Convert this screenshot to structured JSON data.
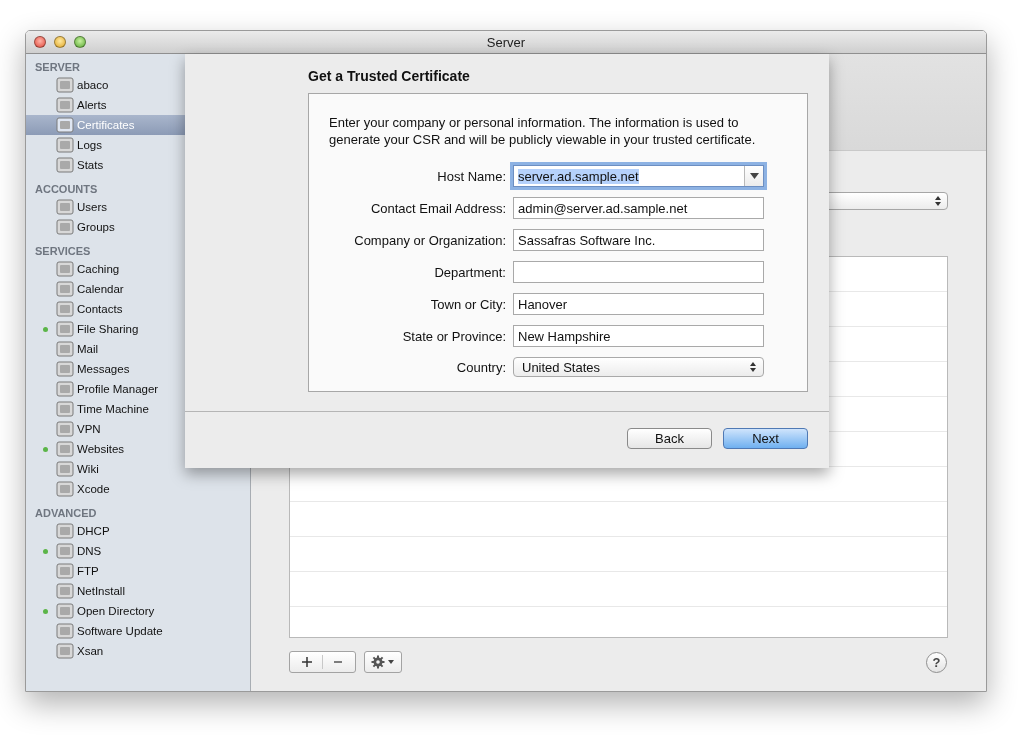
{
  "window": {
    "title": "Server"
  },
  "sidebar": {
    "sections": [
      {
        "heading": "SERVER",
        "items": [
          {
            "label": "abaco",
            "selected": false,
            "running": false
          },
          {
            "label": "Alerts",
            "selected": false,
            "running": false
          },
          {
            "label": "Certificates",
            "selected": true,
            "running": false
          },
          {
            "label": "Logs",
            "selected": false,
            "running": false
          },
          {
            "label": "Stats",
            "selected": false,
            "running": false
          }
        ]
      },
      {
        "heading": "ACCOUNTS",
        "items": [
          {
            "label": "Users",
            "selected": false,
            "running": false
          },
          {
            "label": "Groups",
            "selected": false,
            "running": false
          }
        ]
      },
      {
        "heading": "SERVICES",
        "items": [
          {
            "label": "Caching",
            "selected": false,
            "running": false
          },
          {
            "label": "Calendar",
            "selected": false,
            "running": false
          },
          {
            "label": "Contacts",
            "selected": false,
            "running": false
          },
          {
            "label": "File Sharing",
            "selected": false,
            "running": true
          },
          {
            "label": "Mail",
            "selected": false,
            "running": false
          },
          {
            "label": "Messages",
            "selected": false,
            "running": false
          },
          {
            "label": "Profile Manager",
            "selected": false,
            "running": false
          },
          {
            "label": "Time Machine",
            "selected": false,
            "running": false
          },
          {
            "label": "VPN",
            "selected": false,
            "running": false
          },
          {
            "label": "Websites",
            "selected": false,
            "running": true
          },
          {
            "label": "Wiki",
            "selected": false,
            "running": false
          },
          {
            "label": "Xcode",
            "selected": false,
            "running": false
          }
        ]
      },
      {
        "heading": "ADVANCED",
        "items": [
          {
            "label": "DHCP",
            "selected": false,
            "running": false
          },
          {
            "label": "DNS",
            "selected": false,
            "running": true
          },
          {
            "label": "FTP",
            "selected": false,
            "running": false
          },
          {
            "label": "NetInstall",
            "selected": false,
            "running": false
          },
          {
            "label": "Open Directory",
            "selected": false,
            "running": true
          },
          {
            "label": "Software Update",
            "selected": false,
            "running": false
          },
          {
            "label": "Xsan",
            "selected": false,
            "running": false
          }
        ]
      }
    ]
  },
  "main": {
    "help_button": "?"
  },
  "sheet": {
    "title": "Get a Trusted Certificate",
    "description": "Enter your company or personal information. The information is used to generate your CSR and will be publicly viewable in your trusted certificate.",
    "fields": [
      {
        "label": "Host Name:",
        "kind": "combo",
        "value": "server.ad.sample.net",
        "focused": true
      },
      {
        "label": "Contact Email Address:",
        "kind": "text",
        "value": "admin@server.ad.sample.net",
        "focused": false
      },
      {
        "label": "Company or Organization:",
        "kind": "text",
        "value": "Sassafras Software Inc.",
        "focused": false
      },
      {
        "label": "Department:",
        "kind": "text",
        "focused": false
      },
      {
        "label": "Town or City:",
        "kind": "text",
        "value": "Hanover",
        "focused": false
      },
      {
        "label": "State or Province:",
        "kind": "text",
        "value": "New Hampshire",
        "focused": false
      },
      {
        "label": "Country:",
        "kind": "popup",
        "value": "United States",
        "focused": false
      }
    ],
    "buttons": [
      {
        "label": "Back",
        "default": false
      },
      {
        "label": "Next",
        "default": true
      }
    ]
  }
}
